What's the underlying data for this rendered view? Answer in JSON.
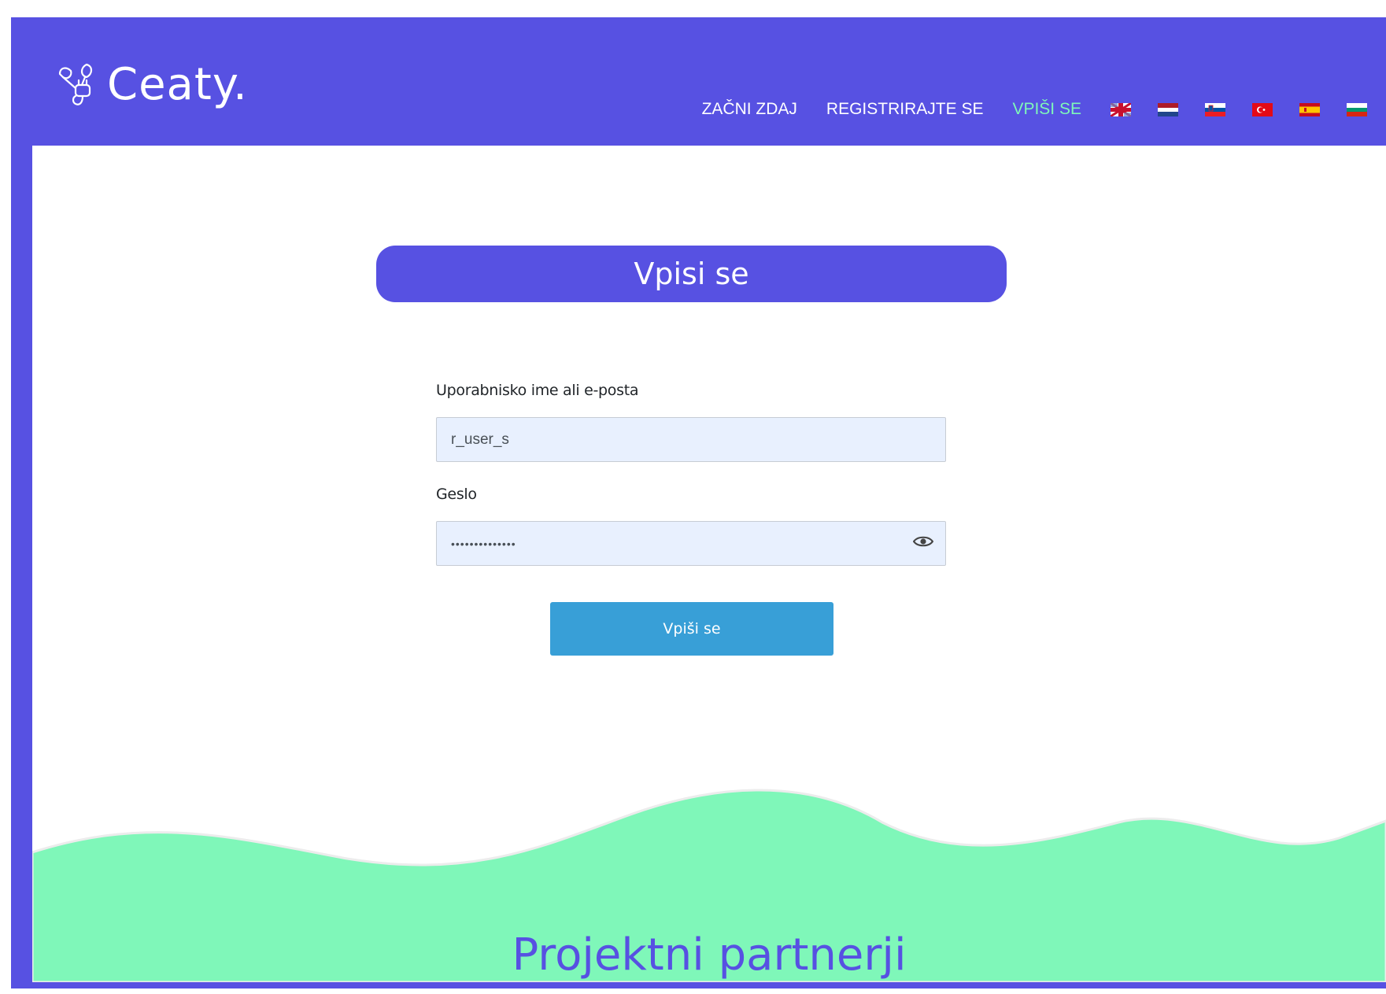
{
  "brand": {
    "name": "Ceaty.",
    "icon": "leaf-plug-icon",
    "primary_color": "#5751e2",
    "accent_color": "#7ff7b9",
    "button_color": "#389fd7"
  },
  "nav": {
    "items": [
      {
        "label": "ZAČNI ZDAJ",
        "active": false
      },
      {
        "label": "REGISTRIRAJTE SE",
        "active": false
      },
      {
        "label": "VPIŠI SE",
        "active": true
      }
    ],
    "languages": [
      {
        "flag": "uk-flag-icon"
      },
      {
        "flag": "netherlands-flag-icon"
      },
      {
        "flag": "slovenia-flag-icon"
      },
      {
        "flag": "turkey-flag-icon"
      },
      {
        "flag": "spain-flag-icon"
      },
      {
        "flag": "bulgaria-flag-icon"
      }
    ]
  },
  "login": {
    "title": "Vpisi se",
    "username_label": "Uporabnisko ime ali e-posta",
    "username_value": "r_user_s",
    "password_label": "Geslo",
    "password_value": "••••••••••••••",
    "show_password_icon": "eye-icon",
    "submit_label": "Vpiši se"
  },
  "footer": {
    "partners_title": "Projektni partnerji"
  }
}
